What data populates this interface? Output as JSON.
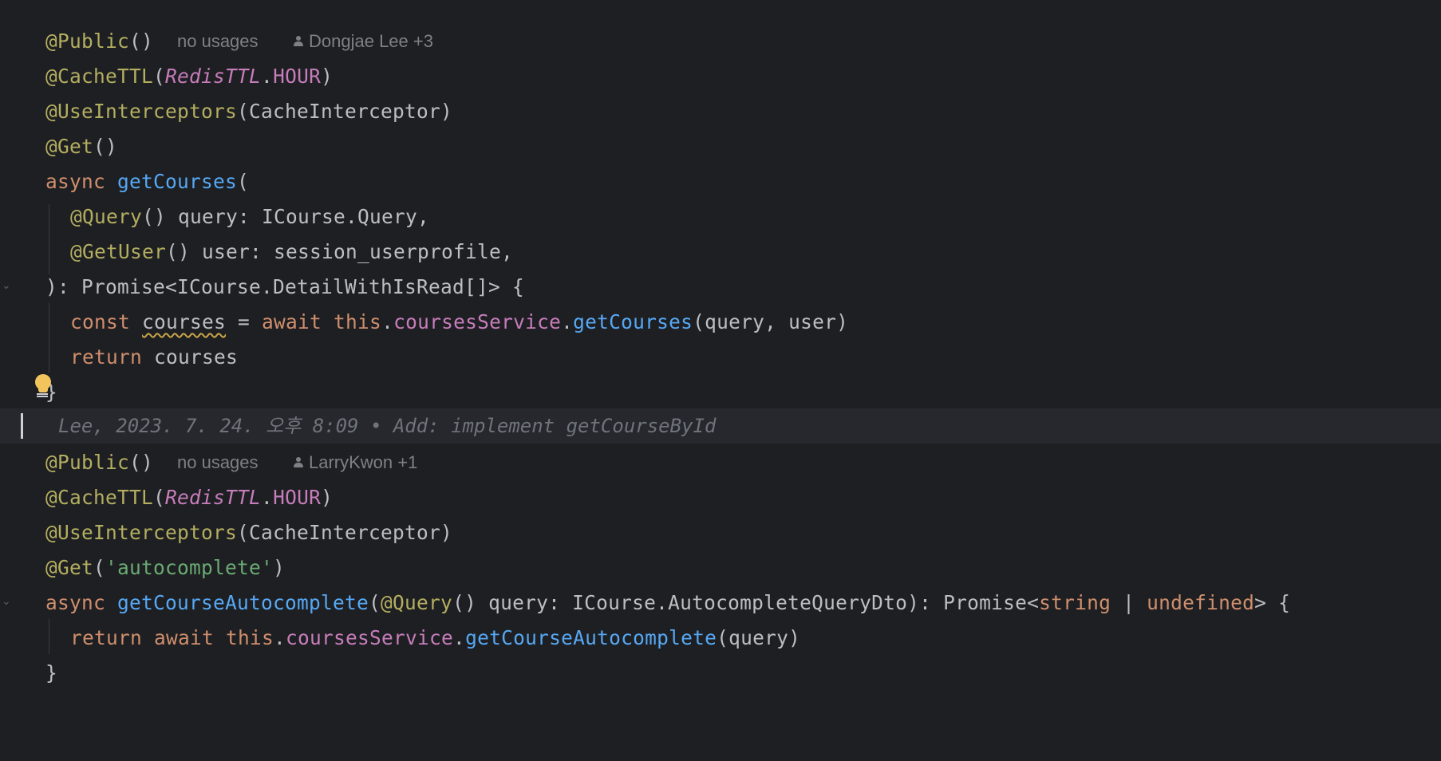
{
  "colors": {
    "background": "#1e1f22",
    "blame_row_background": "#26282e",
    "plain": "#bcbec4",
    "annotation": "#b3ae60",
    "keyword": "#cf8e6d",
    "function": "#56a8f5",
    "field": "#c77dbb",
    "string": "#6aab73",
    "meta_hint": "#7d8086",
    "warning_underline": "#c9a548",
    "bulb": "#f2c55c"
  },
  "icons": {
    "author": "person-icon",
    "intention": "lightbulb-icon",
    "fold": "chevron-down-icon"
  },
  "block1": {
    "hint_usages": "no usages",
    "hint_authors": "Dongjae Lee +3",
    "lines": [
      [
        {
          "t": "@Public",
          "c": "annot"
        },
        {
          "t": "()",
          "c": "plain"
        }
      ],
      [
        {
          "t": "@CacheTTL",
          "c": "annot"
        },
        {
          "t": "(",
          "c": "plain"
        },
        {
          "t": "RedisTTL",
          "c": "static"
        },
        {
          "t": ".",
          "c": "plain"
        },
        {
          "t": "HOUR",
          "c": "field"
        },
        {
          "t": ")",
          "c": "plain"
        }
      ],
      [
        {
          "t": "@UseInterceptors",
          "c": "annot"
        },
        {
          "t": "(CacheInterceptor)",
          "c": "plain"
        }
      ],
      [
        {
          "t": "@Get",
          "c": "annot"
        },
        {
          "t": "()",
          "c": "plain"
        }
      ],
      [
        {
          "t": "async ",
          "c": "kw"
        },
        {
          "t": "getCourses",
          "c": "fn"
        },
        {
          "t": "(",
          "c": "plain"
        }
      ],
      [
        {
          "t": "@Query",
          "c": "annot"
        },
        {
          "t": "() query: ICourse.Query,",
          "c": "plain"
        }
      ],
      [
        {
          "t": "@GetUser",
          "c": "annot"
        },
        {
          "t": "() user: session_userprofile,",
          "c": "plain"
        }
      ],
      [
        {
          "t": "): Promise<ICourse.DetailWithIsRead[]> {",
          "c": "plain"
        }
      ],
      [
        {
          "t": "const ",
          "c": "kw"
        },
        {
          "t": "courses",
          "c": "plain warn"
        },
        {
          "t": " = ",
          "c": "plain"
        },
        {
          "t": "await this",
          "c": "kw"
        },
        {
          "t": ".",
          "c": "plain"
        },
        {
          "t": "coursesService",
          "c": "field"
        },
        {
          "t": ".",
          "c": "plain"
        },
        {
          "t": "getCourses",
          "c": "fn"
        },
        {
          "t": "(query, user)",
          "c": "plain"
        }
      ],
      [
        {
          "t": "return ",
          "c": "kw"
        },
        {
          "t": "courses",
          "c": "plain"
        }
      ],
      [
        {
          "t": "}",
          "c": "plain"
        }
      ]
    ]
  },
  "blame": {
    "text": "Lee, 2023. 7. 24. 오후 8:09 • Add: implement getCourseById"
  },
  "block2": {
    "hint_usages": "no usages",
    "hint_authors": "LarryKwon +1",
    "lines": [
      [
        {
          "t": "@Public",
          "c": "annot"
        },
        {
          "t": "()",
          "c": "plain"
        }
      ],
      [
        {
          "t": "@CacheTTL",
          "c": "annot"
        },
        {
          "t": "(",
          "c": "plain"
        },
        {
          "t": "RedisTTL",
          "c": "static"
        },
        {
          "t": ".",
          "c": "plain"
        },
        {
          "t": "HOUR",
          "c": "field"
        },
        {
          "t": ")",
          "c": "plain"
        }
      ],
      [
        {
          "t": "@UseInterceptors",
          "c": "annot"
        },
        {
          "t": "(CacheInterceptor)",
          "c": "plain"
        }
      ],
      [
        {
          "t": "@Get",
          "c": "annot"
        },
        {
          "t": "(",
          "c": "plain"
        },
        {
          "t": "'autocomplete'",
          "c": "str"
        },
        {
          "t": ")",
          "c": "plain"
        }
      ],
      [
        {
          "t": "async ",
          "c": "kw"
        },
        {
          "t": "getCourseAutocomplete",
          "c": "fn"
        },
        {
          "t": "(",
          "c": "plain"
        },
        {
          "t": "@Query",
          "c": "annot"
        },
        {
          "t": "() query: ICourse.AutocompleteQueryDto): Promise<",
          "c": "plain"
        },
        {
          "t": "string",
          "c": "kw"
        },
        {
          "t": " | ",
          "c": "plain"
        },
        {
          "t": "undefined",
          "c": "kw"
        },
        {
          "t": "> {",
          "c": "plain"
        }
      ],
      [
        {
          "t": "return await this",
          "c": "kw"
        },
        {
          "t": ".",
          "c": "plain"
        },
        {
          "t": "coursesService",
          "c": "field"
        },
        {
          "t": ".",
          "c": "plain"
        },
        {
          "t": "getCourseAutocomplete",
          "c": "fn"
        },
        {
          "t": "(query)",
          "c": "plain"
        }
      ],
      [
        {
          "t": "}",
          "c": "plain"
        }
      ]
    ]
  }
}
